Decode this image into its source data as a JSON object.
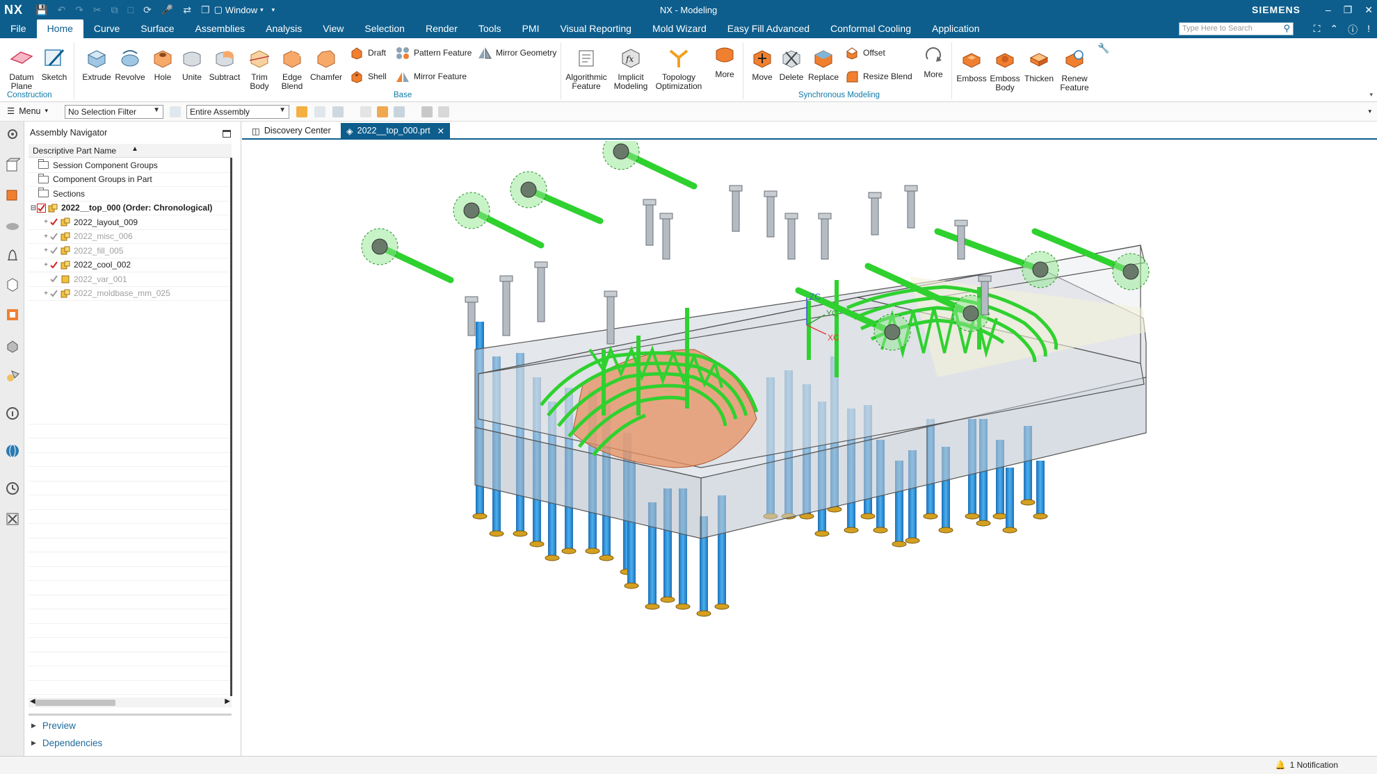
{
  "titlebar": {
    "app_logo": "NX",
    "window_menu": "Window",
    "title": "NX - Modeling",
    "brand": "SIEMENS"
  },
  "menu_tabs": [
    "File",
    "Home",
    "Curve",
    "Surface",
    "Assemblies",
    "Analysis",
    "View",
    "Selection",
    "Render",
    "Tools",
    "PMI",
    "Visual Reporting",
    "Mold Wizard",
    "Easy Fill Advanced",
    "Conformal Cooling",
    "Application"
  ],
  "active_tab": "Home",
  "search": {
    "placeholder": "Type Here to Search"
  },
  "ribbon": {
    "datum_plane": "Datum Plane",
    "sketch": "Sketch",
    "construction_group": "Construction",
    "extrude": "Extrude",
    "revolve": "Revolve",
    "hole": "Hole",
    "unite": "Unite",
    "subtract": "Subtract",
    "trim_body": "Trim Body",
    "edge_blend": "Edge Blend",
    "chamfer": "Chamfer",
    "draft": "Draft",
    "shell": "Shell",
    "pattern_feature": "Pattern Feature",
    "mirror_feature": "Mirror Feature",
    "mirror_geometry": "Mirror Geometry",
    "base_group": "Base",
    "algorithmic_feature": "Algorithmic Feature",
    "implicit_modeling": "Implicit Modeling",
    "topology_optimization": "Topology Optimization",
    "more_1": "More",
    "move": "Move",
    "delete": "Delete",
    "replace": "Replace",
    "offset": "Offset",
    "resize_blend": "Resize Blend",
    "more_2": "More",
    "synchronous_group": "Synchronous Modeling",
    "emboss": "Emboss",
    "emboss_body": "Emboss Body",
    "thicken": "Thicken",
    "renew_feature": "Renew Feature"
  },
  "toolbar": {
    "menu": "Menu",
    "selection_filter": "No Selection Filter",
    "scope": "Entire Assembly"
  },
  "navigator": {
    "title": "Assembly Navigator",
    "column": "Descriptive Part Name",
    "rows": [
      {
        "label": "Session Component Groups"
      },
      {
        "label": "Component Groups in Part"
      },
      {
        "label": "Sections"
      },
      {
        "label": "2022__top_000 (Order: Chronological)"
      },
      {
        "label": "2022_layout_009"
      },
      {
        "label": "2022_misc_006"
      },
      {
        "label": "2022_fill_005"
      },
      {
        "label": "2022_cool_002"
      },
      {
        "label": "2022_var_001"
      },
      {
        "label": "2022_moldbase_mm_025"
      }
    ],
    "preview": "Preview",
    "dependencies": "Dependencies"
  },
  "doc_tabs": {
    "discovery": "Discovery Center",
    "part": "2022__top_000.prt"
  },
  "viewport": {
    "axis_zc": "ZC",
    "axis_yc": "YC",
    "axis_xc": "XC"
  },
  "status": {
    "notification": "1 Notification"
  },
  "colors": {
    "brand_blue": "#0d5e8d",
    "cooling_green": "#2fd12f",
    "pin_blue": "#2a8fd6",
    "accent_orange": "#f08030"
  }
}
